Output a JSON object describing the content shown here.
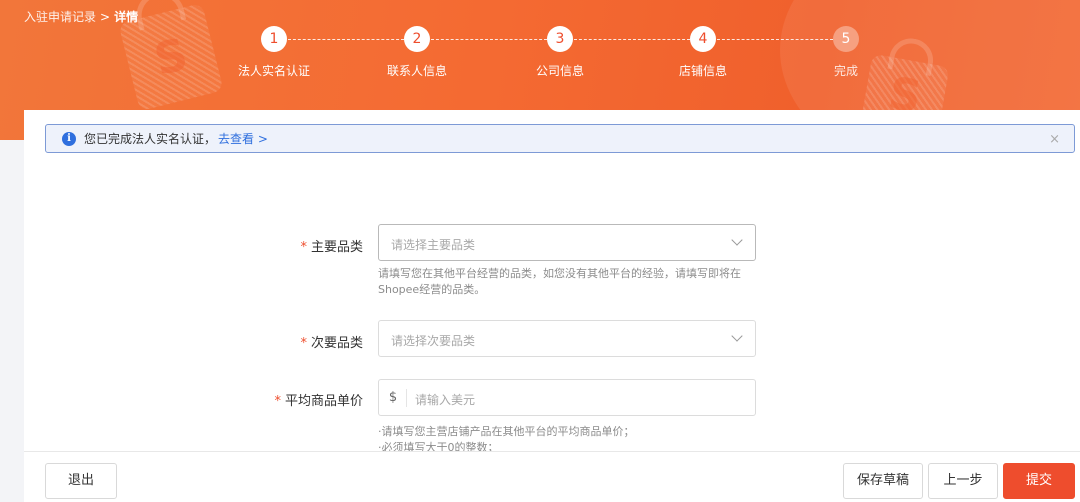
{
  "breadcrumb": {
    "parent": "入驻申请记录",
    "separator": ">",
    "current": "详情"
  },
  "steps": [
    {
      "number": "1",
      "label": "法人实名认证"
    },
    {
      "number": "2",
      "label": "联系人信息"
    },
    {
      "number": "3",
      "label": "公司信息"
    },
    {
      "number": "4",
      "label": "店铺信息"
    },
    {
      "number": "5",
      "label": "完成"
    }
  ],
  "current_step": 4,
  "notice": {
    "text": "您已完成法人实名认证，",
    "link": "去查看 >",
    "close": "×"
  },
  "form": {
    "primary_category": {
      "label": "主要品类",
      "required_mark": "*",
      "placeholder": "请选择主要品类",
      "hint_line1": "请填写您在其他平台经营的品类，如您没有其他平台的经验，请填写即将在",
      "hint_line2": "Shopee经营的品类。"
    },
    "secondary_category": {
      "label": "次要品类",
      "required_mark": "*",
      "placeholder": "请选择次要品类"
    },
    "avg_price": {
      "label": "平均商品单价",
      "required_mark": "*",
      "prefix": "$",
      "placeholder": "请输入美元",
      "hint_line1": "·请填写您主营店铺产品在其他平台的平均商品单价；",
      "hint_line2": "·必须填写大于0的整数；"
    }
  },
  "footer": {
    "exit": "退出",
    "save_draft": "保存草稿",
    "prev": "上一步",
    "submit": "提交"
  },
  "colors": {
    "brand": "#ee4d2d",
    "header": "#f46a32",
    "link": "#2f6fde"
  }
}
